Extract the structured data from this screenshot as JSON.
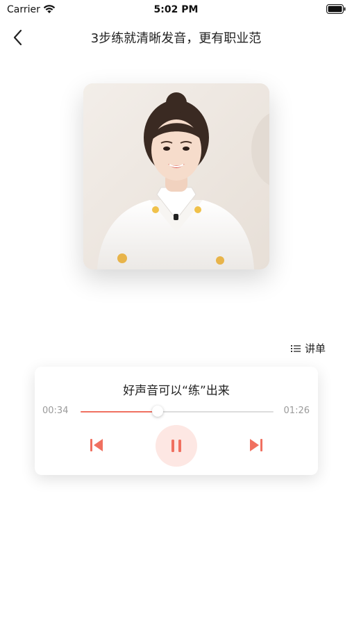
{
  "status_bar": {
    "carrier": "Carrier",
    "time": "5:02 PM",
    "icons": [
      "wifi-icon",
      "battery-icon"
    ]
  },
  "nav": {
    "back_icon": "chevron-left-icon",
    "title": "3步练就清晰发音，更有职业范"
  },
  "cover": {
    "description_icon": "cover-image"
  },
  "playlist": {
    "icon": "list-icon",
    "label": "讲单"
  },
  "player": {
    "track_title": "好声音可以“练”出来",
    "current_time": "00:34",
    "total_time": "01:26",
    "progress": 0.4,
    "state": "playing",
    "accent_color": "#f07060",
    "play_button_bg": "#fde7e3",
    "controls": [
      "previous-icon",
      "pause-icon",
      "next-icon"
    ]
  }
}
